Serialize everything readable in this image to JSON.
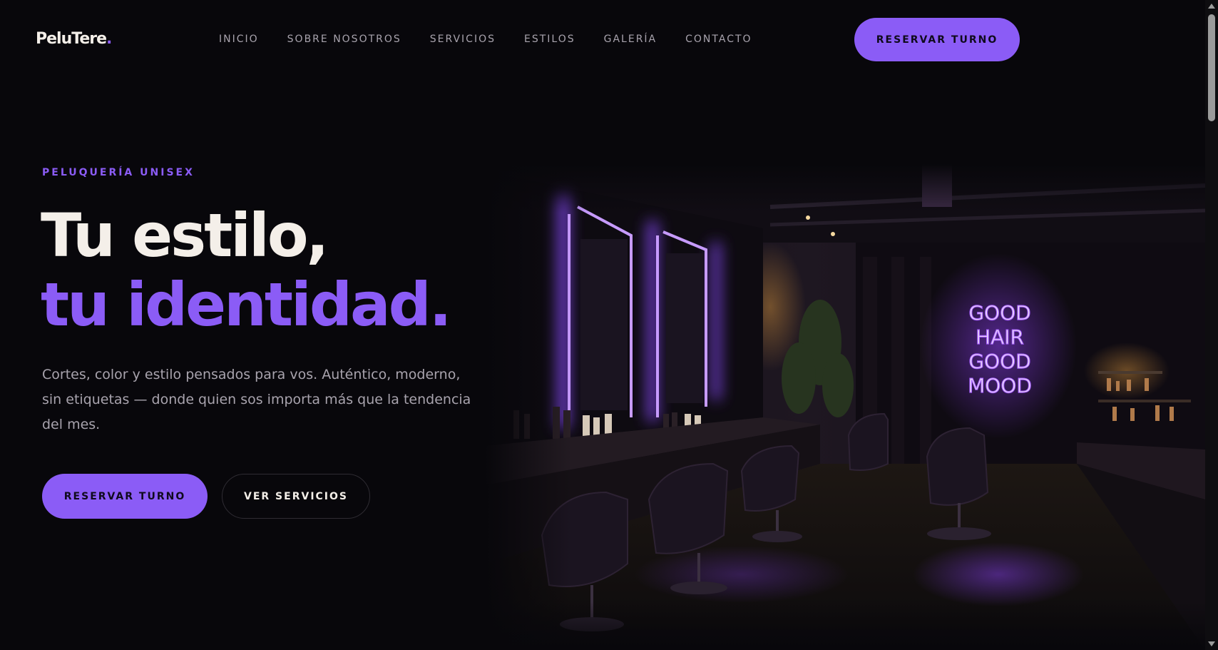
{
  "brand": {
    "name": "PeluTere",
    "dot": ".",
    "accent_color": "#8b5cf6"
  },
  "nav": {
    "items": [
      "INICIO",
      "SOBRE NOSOTROS",
      "SERVICIOS",
      "ESTILOS",
      "GALERÍA",
      "CONTACTO"
    ],
    "cta_label": "RESERVAR TURNO"
  },
  "hero": {
    "eyebrow": "PELUQUERÍA UNISEX",
    "title_line1": "Tu estilo,",
    "title_line2": "tu identidad.",
    "description": "Cortes, color y estilo pensados para vos. Auténtico, moderno, sin etiquetas — donde quien sos importa más que la tendencia del mes.",
    "primary_button": "RESERVAR TURNO",
    "secondary_button": "VER SERVICIOS",
    "image": {
      "icon": "salon-photo",
      "neon_sign": [
        "GOOD",
        "HAIR",
        "GOOD",
        "MOOD"
      ]
    }
  },
  "colors": {
    "background": "#08070b",
    "text_light": "#f4efe9",
    "text_muted": "#a8a3ad",
    "accent": "#8b5cf6"
  }
}
